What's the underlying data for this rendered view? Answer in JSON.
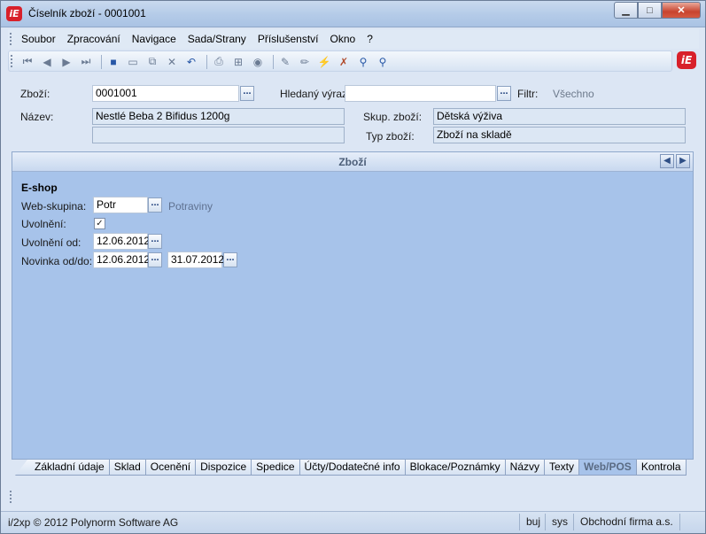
{
  "window": {
    "title": "Číselník zboží - 0001001",
    "app_icon": "iE"
  },
  "menu": [
    "Soubor",
    "Zpracování",
    "Navigace",
    "Sada/Strany",
    "Příslušenství",
    "Okno",
    "?"
  ],
  "header": {
    "zbozi_label": "Zboží:",
    "zbozi_value": "0001001",
    "hledany_label": "Hledaný výraz:",
    "hledany_value": "",
    "filtr_label": "Filtr:",
    "filtr_value": "Všechno",
    "nazev_label": "Název:",
    "nazev_value": "Nestlé Beba 2 Bifidus 1200g",
    "nazev2_value": "",
    "skup_label": "Skup. zboží:",
    "skup_value": "Dětská výživa",
    "typ_label": "Typ zboží:",
    "typ_value": "Zboží na skladě",
    "lookup": "..."
  },
  "panel": {
    "title": "Zboží",
    "section": "E-shop",
    "web_skupina_label": "Web-skupina:",
    "web_skupina_value": "Potr",
    "web_skupina_desc": "Potraviny",
    "uvolneni_label": "Uvolnění:",
    "uvolneni_checked": "✓",
    "uvolneni_od_label": "Uvolnění od:",
    "uvolneni_od_value": "12.06.2012",
    "novinka_label": "Novinka od/do:",
    "novinka_od_value": "12.06.2012",
    "novinka_do_value": "31.07.2012"
  },
  "tabs": [
    "Základní údaje",
    "Sklad",
    "Ocenění",
    "Dispozice",
    "Spedice",
    "Účty/Dodatečné info",
    "Blokace/Poznámky",
    "Názvy",
    "Texty",
    "Web/POS",
    "Kontrola"
  ],
  "active_tab": "Web/POS",
  "status": {
    "copyright": "i/2xp © 2012 Polynorm Software AG",
    "user": "buj",
    "db": "sys",
    "company": "Obchodní firma a.s."
  }
}
